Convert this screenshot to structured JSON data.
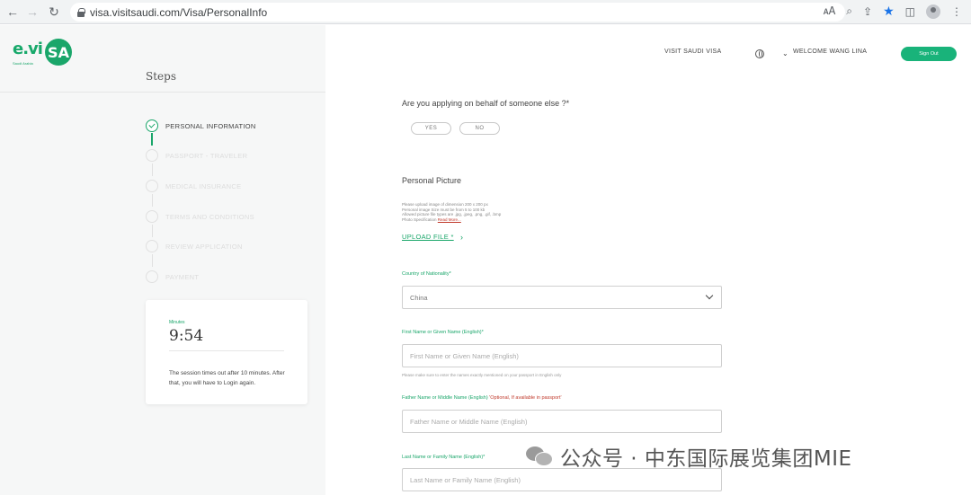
{
  "browser": {
    "url": "visa.visitsaudi.com/Visa/PersonalInfo",
    "icons": [
      "back-icon",
      "forward-icon",
      "reload-icon",
      "lock-icon",
      "translate-icon",
      "zoom-icon",
      "share-icon",
      "star-icon",
      "sidepanel-icon",
      "profile-icon"
    ]
  },
  "logo": {
    "text": "e.vi",
    "circle": "SA",
    "tagline": "Saudi Arabia"
  },
  "sidebar": {
    "steps_title": "Steps",
    "steps": [
      {
        "label": "PERSONAL INFORMATION",
        "state": "active"
      },
      {
        "label": "PASSPORT - TRAVELER",
        "state": "pending"
      },
      {
        "label": "MEDICAL INSURANCE",
        "state": "pending"
      },
      {
        "label": "TERMS AND CONDITIONS",
        "state": "pending"
      },
      {
        "label": "REVIEW APPLICATION",
        "state": "pending"
      },
      {
        "label": "PAYMENT",
        "state": "pending"
      }
    ],
    "timer": {
      "label": "Minutes",
      "time": "9:54",
      "message": "The session times out after 10 minutes. After that, you will have to Login again."
    }
  },
  "header": {
    "visit_link": "VISIT SAUDI VISA",
    "welcome": "WELCOME WANG LINA",
    "signout": "Sign Out"
  },
  "form": {
    "behalf_question": "Are you applying on behalf of someone else ?*",
    "yes": "YES",
    "no": "NO",
    "picture_title": "Personal Picture",
    "picture_info": [
      "Please upload image of dimension 200 x 200 px",
      "Personal image Size must be from 5 to 100 kb",
      "Allowed picture file types are .jpg, .jpeg, .png, .gif, .bmp",
      "Photo Specification"
    ],
    "read_more": "Read More...",
    "upload": "UPLOAD FILE *",
    "nationality_label": "Country of Nationality*",
    "nationality_value": "China",
    "first_name_label": "First Name or Given Name (English)*",
    "first_name_placeholder": "First Name or Given Name (English)",
    "helper": "Please make sure to enter the names exactly mentioned on your passport in English only",
    "father_label": "Father Name or Middle Name (English)",
    "father_optional": "'Optional, If available in passport'",
    "father_placeholder": "Father Name or Middle Name (English)",
    "last_name_label": "Last Name or Family Name (English)*",
    "last_name_placeholder": "Last Name or Family Name (English)"
  },
  "watermark": {
    "text": "公众号 · 中东国际展览集团MIE"
  },
  "colors": {
    "brand": "#1aa66a",
    "signout_bg": "#19b37a",
    "optional": "#c0392b"
  }
}
